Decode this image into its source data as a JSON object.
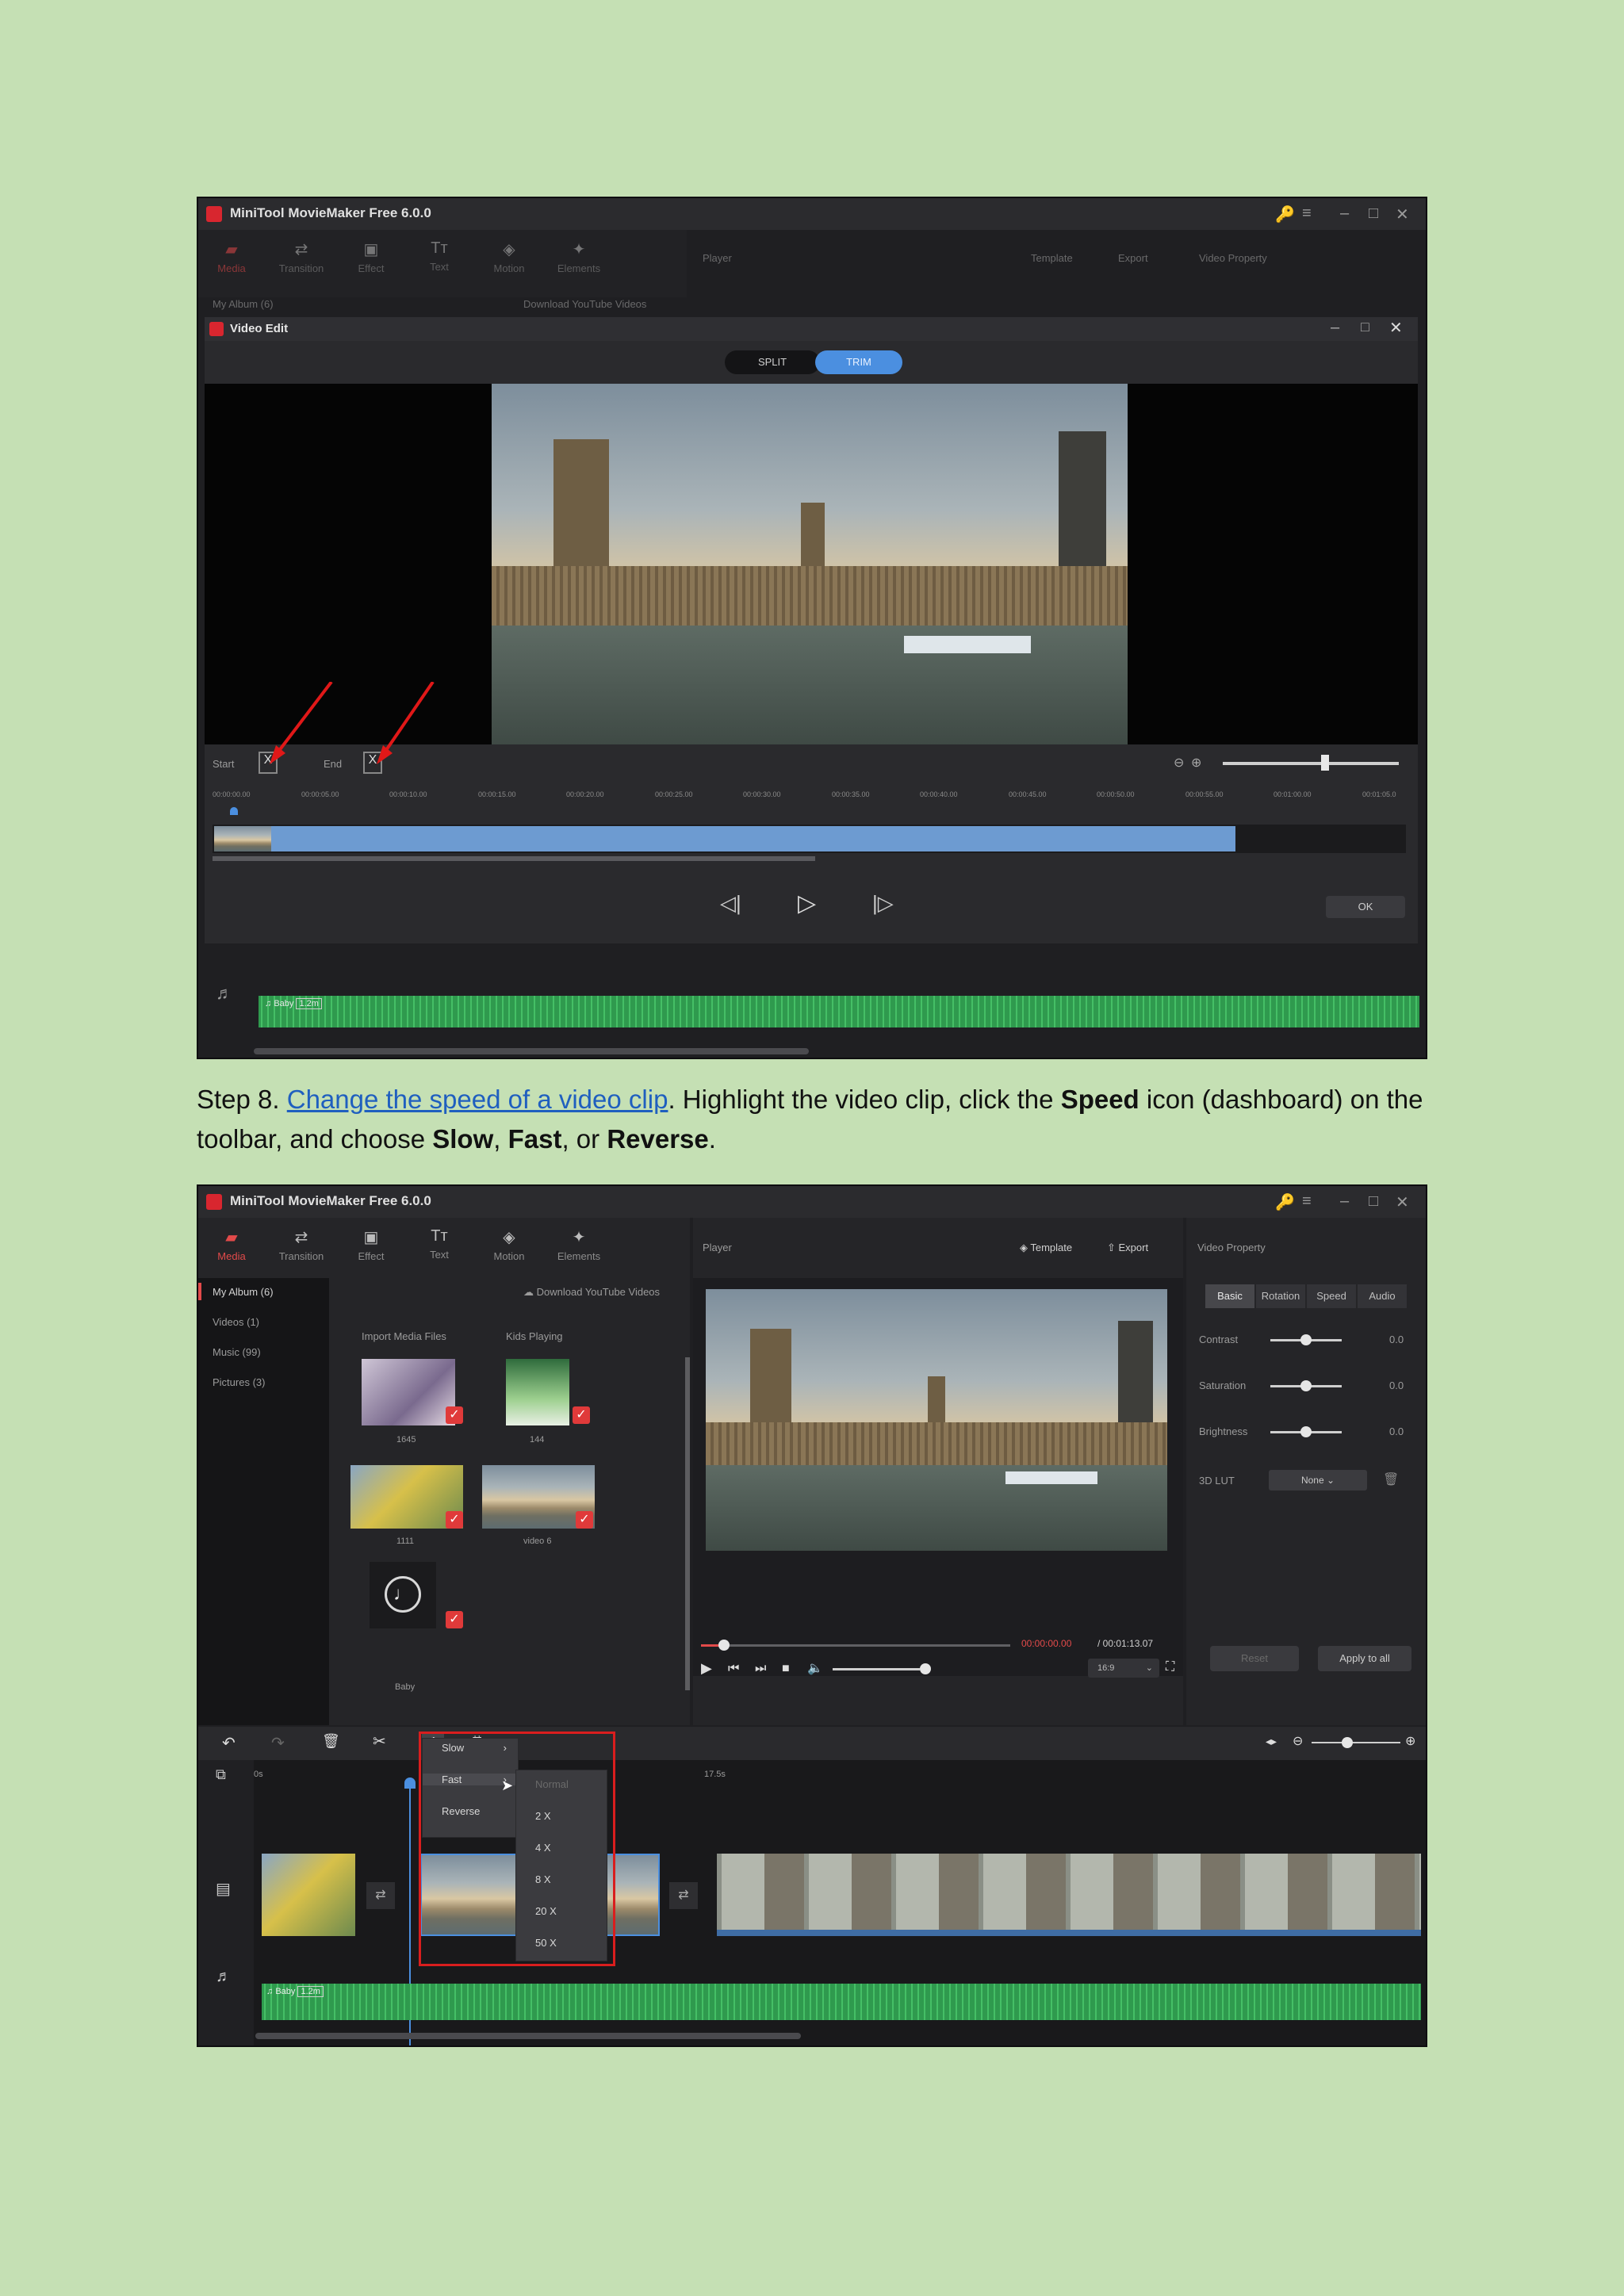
{
  "screenshot1": {
    "app_title": "MiniTool MovieMaker Free 6.0.0",
    "nav": [
      "Media",
      "Transition",
      "Effect",
      "Text",
      "Motion",
      "Elements"
    ],
    "player_label": "Player",
    "template_label": "Template",
    "export_label": "Export",
    "property_label": "Video Property",
    "album_label": "My Album (6)",
    "download_label": "Download YouTube Videos",
    "dialog_title": "Video Edit",
    "split_label": "SPLIT",
    "trim_label": "TRIM",
    "start_label": "Start",
    "end_label": "End",
    "ok_label": "OK",
    "audio_label": "Baby",
    "audio_duration": "1.2m",
    "ruler_ticks": [
      "00:00:00.00",
      "00:00:05.00",
      "00:00:10.00",
      "00:00:15.00",
      "00:00:20.00",
      "00:00:25.00",
      "00:00:30.00",
      "00:00:35.00",
      "00:00:40.00",
      "00:00:45.00",
      "00:00:50.00",
      "00:00:55.00",
      "00:01:00.00",
      "00:01:05.0"
    ]
  },
  "paragraph": {
    "prefix": "Step 8. ",
    "link": "Change the speed of a video clip",
    "t1": ". Highlight the video clip, click the ",
    "b1": "Speed",
    "t2": " icon (dashboard) on the toolbar, and choose ",
    "b2": "Slow",
    "t3": ", ",
    "b3": "Fast",
    "t4": ", or ",
    "b4": "Reverse",
    "t5": "."
  },
  "screenshot2": {
    "app_title": "MiniTool MovieMaker Free 6.0.0",
    "nav": [
      "Media",
      "Transition",
      "Effect",
      "Text",
      "Motion",
      "Elements"
    ],
    "player_label": "Player",
    "template_label": "Template",
    "export_label": "Export",
    "property_label": "Video Property",
    "album_items": [
      "My Album (6)",
      "Videos (1)",
      "Music (99)",
      "Pictures (3)"
    ],
    "download_label": "Download YouTube Videos",
    "media_top_labels": [
      "Import Media Files",
      "Kids Playing"
    ],
    "media_labels": [
      "1645",
      "144",
      "1111",
      "video 6",
      "Baby"
    ],
    "prop_tabs": [
      "Basic",
      "Rotation",
      "Speed",
      "Audio"
    ],
    "props": [
      {
        "label": "Contrast",
        "value": "0.0"
      },
      {
        "label": "Saturation",
        "value": "0.0"
      },
      {
        "label": "Brightness",
        "value": "0.0"
      }
    ],
    "lut_label": "3D LUT",
    "lut_value": "None",
    "reset_label": "Reset",
    "apply_label": "Apply to all",
    "time_current": "00:00:00.00",
    "time_total": "/ 00:01:13.07",
    "aspect": "16:9",
    "ruler": [
      "0s",
      "17.5s"
    ],
    "speed_menu": [
      "Slow",
      "Fast",
      "Reverse"
    ],
    "fast_submenu": [
      "Normal",
      "2 X",
      "4 X",
      "8 X",
      "20 X",
      "50 X"
    ],
    "audio_label": "Baby",
    "audio_duration": "1.2m"
  }
}
